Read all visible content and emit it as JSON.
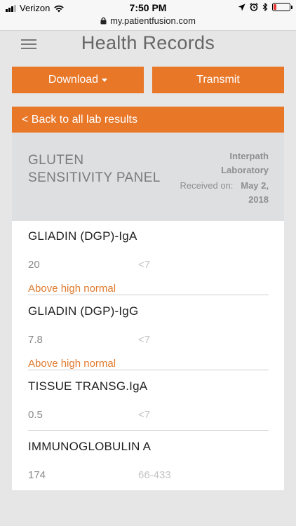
{
  "status_bar": {
    "carrier": "Verizon",
    "time": "7:50 PM"
  },
  "browser": {
    "url": "my.patientfusion.com"
  },
  "header": {
    "title": "Health Records"
  },
  "actions": {
    "download_label": "Download",
    "transmit_label": "Transmit",
    "back_label": "< Back to all lab results"
  },
  "panel": {
    "title": "GLUTEN SENSITIVITY PANEL",
    "lab": "Interpath Laboratory",
    "received_label": "Received on:",
    "received_date": "May 2, 2018"
  },
  "results": [
    {
      "name": "GLIADIN (DGP)-IgA",
      "value": "20",
      "range": "<7",
      "flag": "Above high normal"
    },
    {
      "name": "GLIADIN (DGP)-IgG",
      "value": "7.8",
      "range": "<7",
      "flag": "Above high normal"
    },
    {
      "name": "TISSUE TRANSG.IgA",
      "value": "0.5",
      "range": "<7",
      "flag": ""
    },
    {
      "name": "IMMUNOGLOBULIN A",
      "value": "174",
      "range": "66-433",
      "flag": ""
    }
  ],
  "colors": {
    "accent": "#e87728",
    "flag": "#e07a2e",
    "background": "#e6e6e7"
  },
  "icons": [
    "signal-icon",
    "wifi-icon",
    "lock-icon",
    "location-icon",
    "alarm-icon",
    "bluetooth-icon",
    "battery-icon",
    "hamburger-icon",
    "caret-down-icon"
  ]
}
